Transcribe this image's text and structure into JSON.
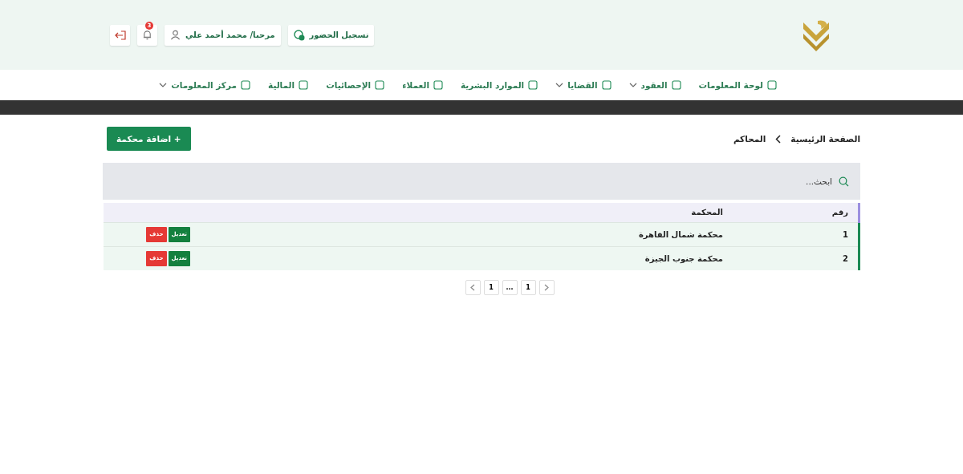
{
  "header": {
    "attendance_button": "تسجيل الحضور",
    "user_button": "مرحبا/ محمد أحمد علي",
    "notifications": {
      "count": "3"
    }
  },
  "nav": [
    {
      "label": "لوحة المعلومات",
      "kind": "link"
    },
    {
      "label": "العقود",
      "kind": "dropdown"
    },
    {
      "label": "القضايا",
      "kind": "dropdown"
    },
    {
      "label": "الموارد البشرية",
      "kind": "link"
    },
    {
      "label": "العملاء",
      "kind": "link"
    },
    {
      "label": "الإحصائيات",
      "kind": "link"
    },
    {
      "label": "المالية",
      "kind": "link"
    },
    {
      "label": "مركز المعلومات",
      "kind": "dropdown"
    }
  ],
  "breadcrumb": [
    "الصفحة الرئيسية",
    "المحاكم"
  ],
  "add_button": "+ اضافة محكمة",
  "search": {
    "placeholder": "ابحث..."
  },
  "table": {
    "columns": [
      "رقم",
      "المحكمة"
    ],
    "rows": [
      {
        "cells": [
          "1",
          "محكمة شمال القاهرة"
        ],
        "actions": [
          "تعديل",
          "حذف"
        ]
      },
      {
        "cells": [
          "2",
          "محكمة جنوب الجيزة"
        ],
        "actions": [
          "تعديل",
          "حذف"
        ]
      }
    ]
  },
  "pagination": [
    {
      "kind": "prev"
    },
    {
      "kind": "page",
      "label": "1"
    },
    {
      "kind": "page",
      "label": "..."
    },
    {
      "kind": "page",
      "label": "1"
    },
    {
      "kind": "next"
    }
  ]
}
